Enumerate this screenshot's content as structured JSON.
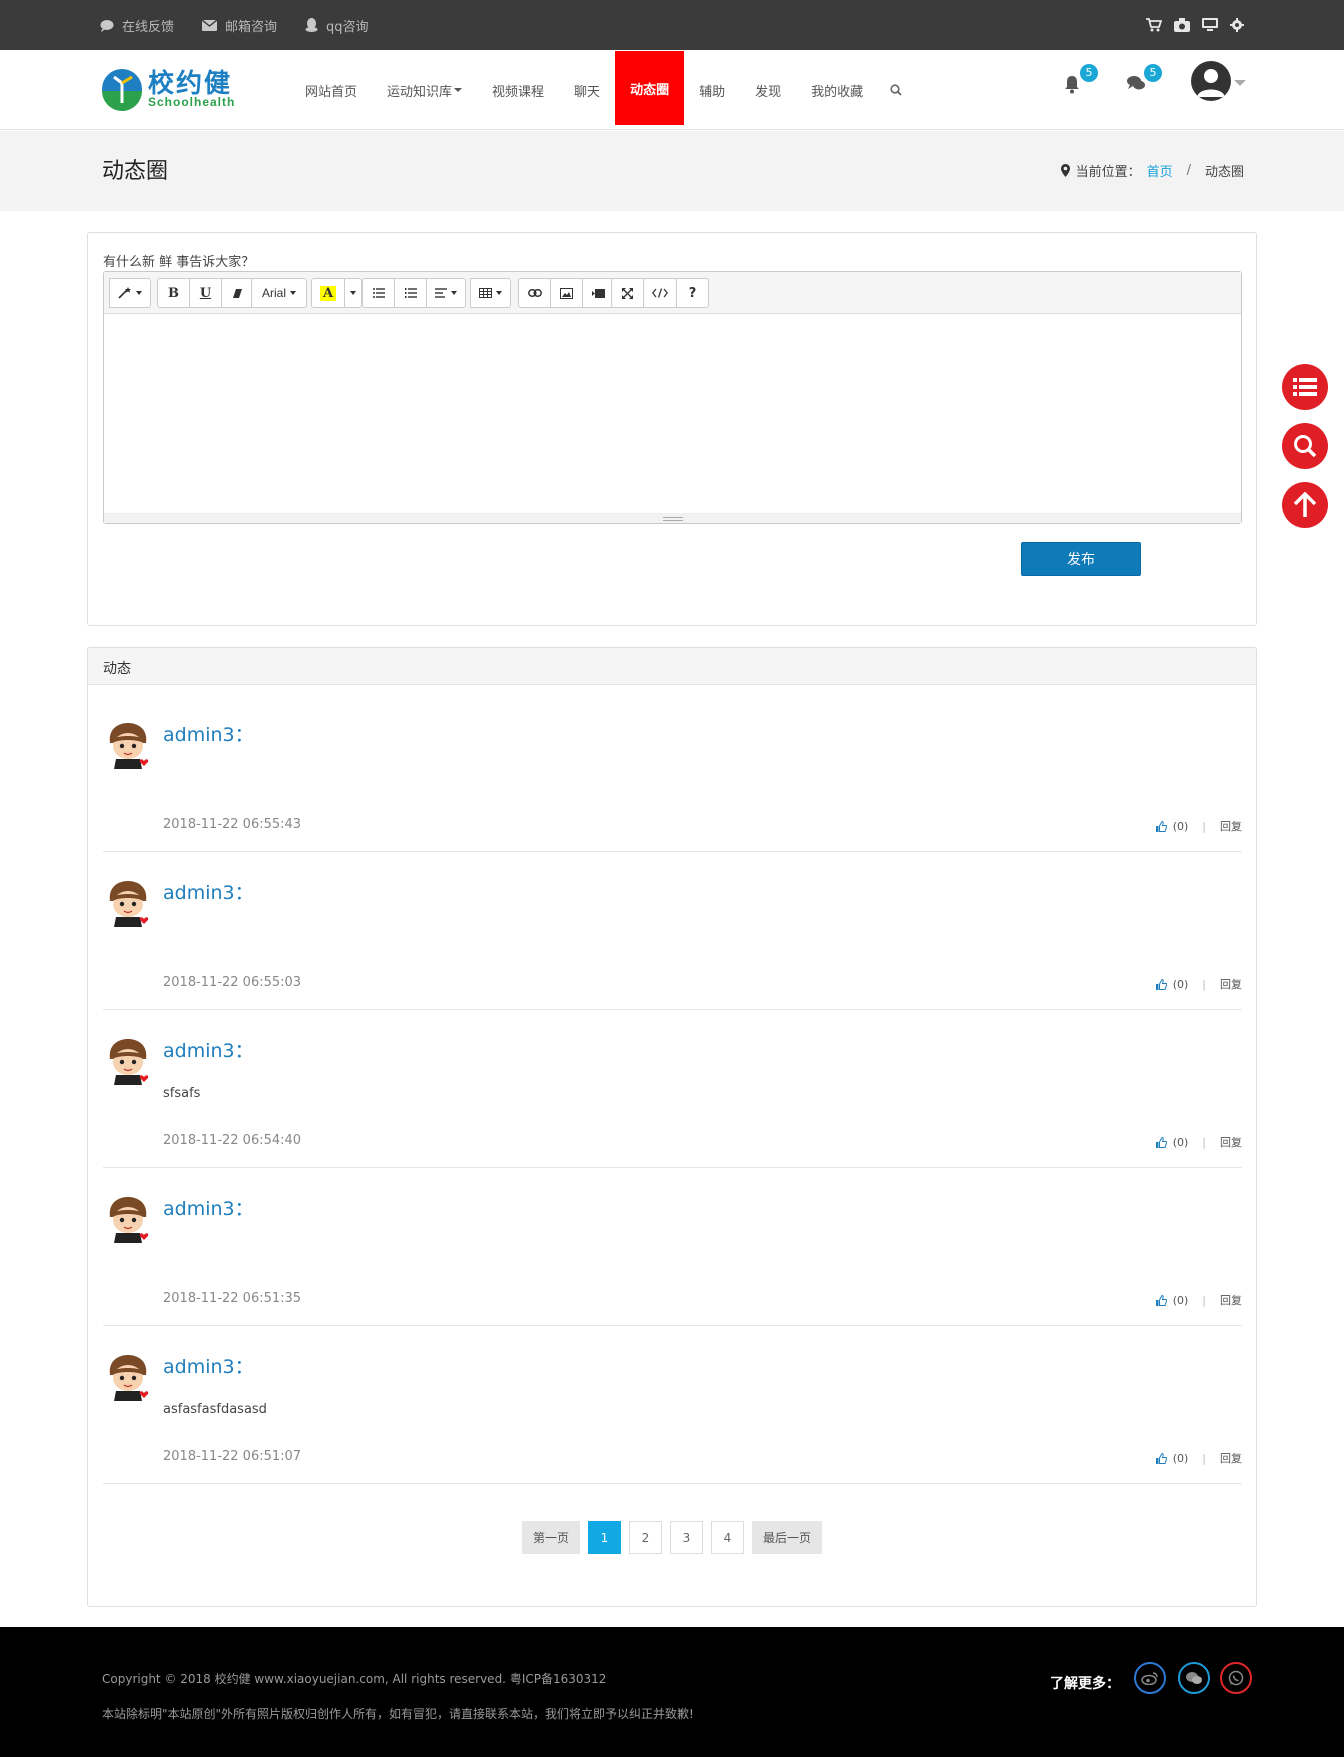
{
  "topbar": {
    "links": [
      {
        "icon": "comment-icon",
        "label": "在线反馈"
      },
      {
        "icon": "envelope-icon",
        "label": "邮箱咨询"
      },
      {
        "icon": "qq-icon",
        "label": "qq咨询"
      }
    ],
    "right_icons": [
      "cart-icon",
      "camera-icon",
      "desktop-icon",
      "gear-icon"
    ]
  },
  "brand": {
    "name": "校约健",
    "tagline": "Schoolhealth"
  },
  "nav": {
    "items": [
      "网站首页",
      "运动知识库",
      "视频课程",
      "聊天",
      "动态圈",
      "辅助",
      "发现",
      "我的收藏"
    ],
    "active": "动态圈",
    "notifications": 5,
    "messages": 5
  },
  "page": {
    "title": "动态圈",
    "crumb_prefix": "当前位置：",
    "crumb_home": "首页",
    "crumb_sep": "/",
    "crumb_current": "动态圈"
  },
  "composer": {
    "prompt": "有什么新 鲜 事告诉大家？",
    "font": "Arial",
    "publish_label": "发布"
  },
  "feed": {
    "header": "动态",
    "posts": [
      {
        "user": "admin3：",
        "body": "",
        "time": "2018-11-22 06:55:43",
        "likes": "(0)",
        "reply": "回复"
      },
      {
        "user": "admin3：",
        "body": "",
        "time": "2018-11-22 06:55:03",
        "likes": "(0)",
        "reply": "回复"
      },
      {
        "user": "admin3：",
        "body": "sfsafs",
        "time": "2018-11-22 06:54:40",
        "likes": "(0)",
        "reply": "回复"
      },
      {
        "user": "admin3：",
        "body": "",
        "time": "2018-11-22 06:51:35",
        "likes": "(0)",
        "reply": "回复"
      },
      {
        "user": "admin3：",
        "body": "asfasfasfdasasd",
        "time": "2018-11-22 06:51:07",
        "likes": "(0)",
        "reply": "回复"
      }
    ]
  },
  "pager": {
    "first": "第一页",
    "pages": [
      "1",
      "2",
      "3",
      "4"
    ],
    "current": "1",
    "last": "最后一页"
  },
  "footer": {
    "copyright": "Copyright © 2018 校约健 www.xiaoyuejian.com, All rights reserved. 粤ICP备1630312",
    "notice": "本站除标明\"本站原创\"外所有照片版权归创作人所有，如有冒犯，请直接联系本站，我们将立即予以纠正并致歉!",
    "more_label": "了解更多：",
    "social": [
      "weibo-icon",
      "wechat-icon",
      "whatsapp-icon"
    ]
  },
  "colors": {
    "accent": "#1aa0d8",
    "active_nav": "#ff0000",
    "fab": "#e01e25",
    "publish": "#0e7ab8"
  }
}
